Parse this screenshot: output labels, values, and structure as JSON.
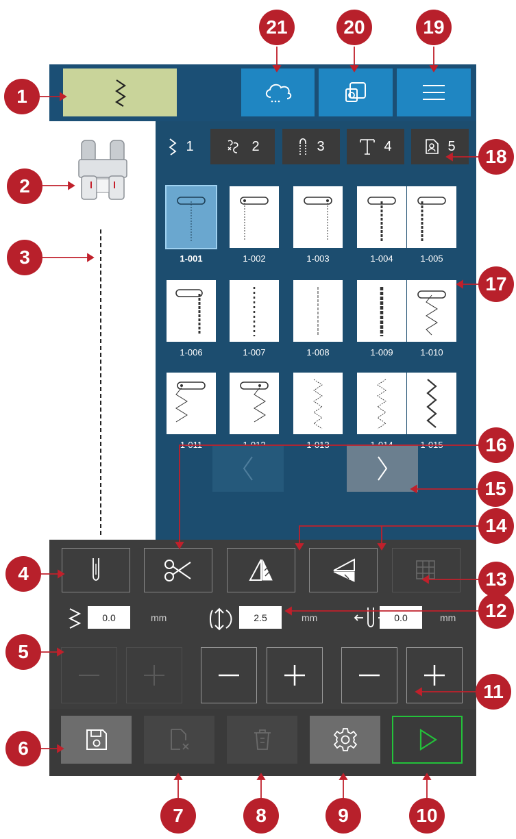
{
  "tabs": [
    {
      "number": "1",
      "icon": "zigzag-stitch-icon"
    },
    {
      "number": "2",
      "icon": "decorative-stitch-icon"
    },
    {
      "number": "3",
      "icon": "buttonhole-icon"
    },
    {
      "number": "4",
      "icon": "font-icon"
    },
    {
      "number": "5",
      "icon": "personal-stitch-icon"
    }
  ],
  "active_tab": "1",
  "stitches": [
    {
      "label": "1-001",
      "selected": true
    },
    {
      "label": "1-002"
    },
    {
      "label": "1-003"
    },
    {
      "label": "1-004"
    },
    {
      "label": "1-005"
    },
    {
      "label": "1-006"
    },
    {
      "label": "1-007"
    },
    {
      "label": "1-008"
    },
    {
      "label": "1-009"
    },
    {
      "label": "1-010"
    },
    {
      "label": "1-011"
    },
    {
      "label": "1-012"
    },
    {
      "label": "1-013"
    },
    {
      "label": "1-014"
    },
    {
      "label": "1-015"
    }
  ],
  "params": {
    "width_value": "0.0",
    "length_value": "2.5",
    "position_value": "0.0",
    "unit": "mm"
  },
  "callouts": [
    "1",
    "2",
    "3",
    "4",
    "5",
    "6",
    "7",
    "8",
    "9",
    "10",
    "11",
    "12",
    "13",
    "14",
    "15",
    "16",
    "17",
    "18",
    "19",
    "20",
    "21"
  ],
  "colors": {
    "top_bar": "#1b4f75",
    "top_button": "#1f86c2",
    "stitch_mode_button": "#c9d49a",
    "panel": "#1c4d6f",
    "controls_bg": "#3d3d3d",
    "callout": "#b8202b",
    "start_button_border": "#23c23a"
  }
}
